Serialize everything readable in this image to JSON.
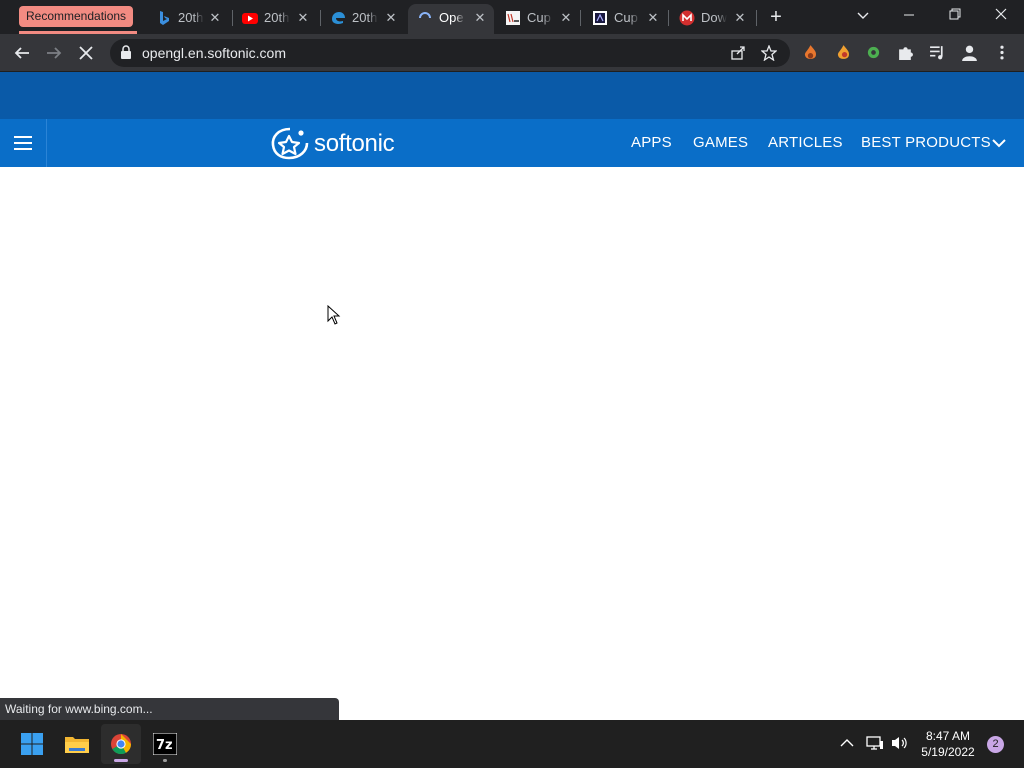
{
  "browser": {
    "tab_group_label": "Recommendations",
    "tabs": [
      {
        "title": "20th",
        "icon": "bing-icon"
      },
      {
        "title": "20th",
        "icon": "youtube-icon"
      },
      {
        "title": "20th",
        "icon": "edge-icon"
      },
      {
        "title": "Ope",
        "icon": "loading-spinner-icon",
        "active": true
      },
      {
        "title": "Cup",
        "icon": "document-icon"
      },
      {
        "title": "Cup",
        "icon": "dark-page-icon"
      },
      {
        "title": "Dow",
        "icon": "m-logo-icon"
      }
    ],
    "url": "opengl.en.softonic.com",
    "status_text": "Waiting for www.bing.com..."
  },
  "site": {
    "logo_text": "softonic",
    "nav": [
      "APPS",
      "GAMES",
      "ARTICLES",
      "BEST PRODUCTS"
    ]
  },
  "taskbar": {
    "time": "8:47 AM",
    "date": "5/19/2022",
    "notification_count": "2"
  },
  "colors": {
    "ad_bar": "#0a5aa8",
    "site_nav": "#0a6ec8",
    "tab_group": "#f28b82"
  }
}
